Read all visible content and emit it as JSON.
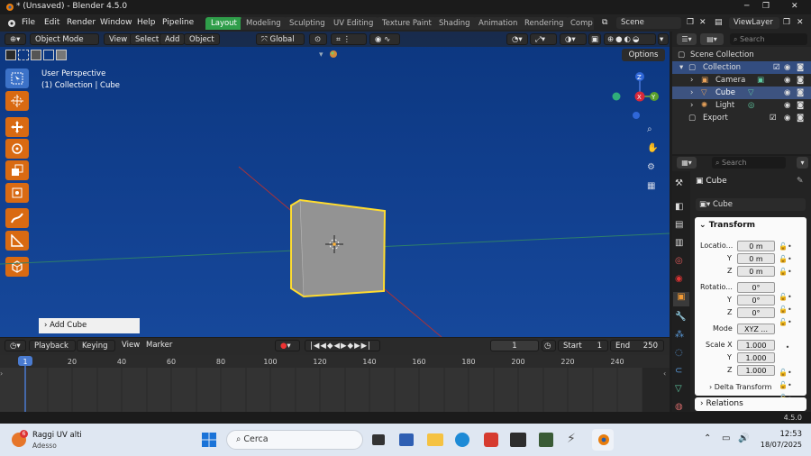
{
  "window": {
    "title": "* (Unsaved) - Blender 4.5.0"
  },
  "menu": [
    "File",
    "Edit",
    "Render",
    "Window",
    "Help",
    "Pipeline"
  ],
  "workspaces": [
    "Layout",
    "Modeling",
    "Sculpting",
    "UV Editing",
    "Texture Paint",
    "Shading",
    "Animation",
    "Rendering",
    "Comp"
  ],
  "scene": {
    "scene_name": "Scene",
    "view_layer": "ViewLayer"
  },
  "viewport": {
    "mode": "Object Mode",
    "menus": [
      "View",
      "Select",
      "Add",
      "Object"
    ],
    "transform_orientation": "Global",
    "options_label": "Options",
    "overlay_line1": "User Perspective",
    "overlay_line2": "(1) Collection | Cube",
    "operator_panel": "Add Cube",
    "gizmo_axes": {
      "x": "X",
      "y": "Y",
      "z": "Z"
    }
  },
  "outliner": {
    "search_placeholder": "Search",
    "root": "Scene Collection",
    "items": [
      {
        "label": "Collection"
      },
      {
        "label": "Camera"
      },
      {
        "label": "Cube"
      },
      {
        "label": "Light"
      },
      {
        "label": "Export"
      }
    ]
  },
  "properties": {
    "search_placeholder": "Search",
    "object_name": "Cube",
    "object_field": "Cube",
    "transform_title": "Transform",
    "location_label": "Locatio...",
    "location": [
      "0 m",
      "0 m",
      "0 m"
    ],
    "rotation_label": "Rotatio...",
    "rotation": [
      "0°",
      "0°",
      "0°"
    ],
    "mode_label": "Mode",
    "mode_value": "XYZ ...",
    "scale_label": "Scale X",
    "scale": [
      "1.000",
      "1.000",
      "1.000"
    ],
    "axis_labels": [
      "Y",
      "Z"
    ],
    "delta_transform": "Delta Transform",
    "relations": "Relations"
  },
  "timeline": {
    "menus": [
      "Playback",
      "Keying",
      "View",
      "Marker"
    ],
    "current_frame": "1",
    "start_label": "Start",
    "start": "1",
    "end_label": "End",
    "end": "250",
    "ticks": [
      "1",
      "20",
      "40",
      "60",
      "80",
      "100",
      "120",
      "140",
      "160",
      "180",
      "200",
      "220",
      "240"
    ]
  },
  "status": {
    "version": "4.5.0"
  },
  "taskbar": {
    "notification_count": "6",
    "weather_title": "Raggi UV alti",
    "weather_sub": "Adesso",
    "search_placeholder": "Cerca",
    "time": "12:53",
    "date": "18/07/2025"
  }
}
